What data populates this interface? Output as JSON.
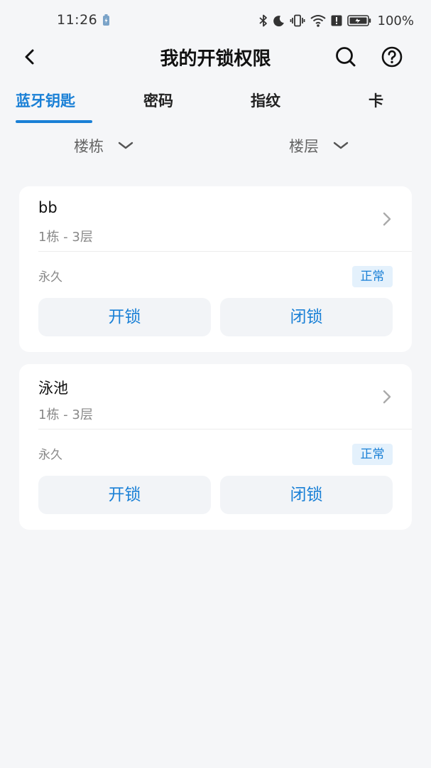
{
  "status_bar": {
    "time": "11:26",
    "battery_percent": "100%",
    "icons": [
      "battery-saver-icon",
      "bluetooth-icon",
      "moon-icon",
      "vibrate-icon",
      "wifi-icon",
      "alert-icon",
      "battery-icon"
    ]
  },
  "header": {
    "title": "我的开锁权限",
    "icons": [
      "back-arrow-icon",
      "search-icon",
      "help-icon"
    ]
  },
  "tabs": [
    {
      "label": "蓝牙钥匙",
      "active": true
    },
    {
      "label": "密码",
      "active": false
    },
    {
      "label": "指纹",
      "active": false
    },
    {
      "label": "卡",
      "active": false
    }
  ],
  "filters": {
    "building": "楼栋",
    "floor": "楼层"
  },
  "keys": [
    {
      "name": "bb",
      "location": "1栋 - 3层",
      "validity": "永久",
      "status": "正常",
      "unlock_label": "开锁",
      "lock_label": "闭锁"
    },
    {
      "name": "泳池",
      "location": "1栋 - 3层",
      "validity": "永久",
      "status": "正常",
      "unlock_label": "开锁",
      "lock_label": "闭锁"
    }
  ],
  "colors": {
    "accent": "#1a80d6",
    "background": "#f5f6f8",
    "card": "#ffffff",
    "status_badge_bg": "#e4f1fc",
    "button_bg": "#f2f4f7"
  }
}
